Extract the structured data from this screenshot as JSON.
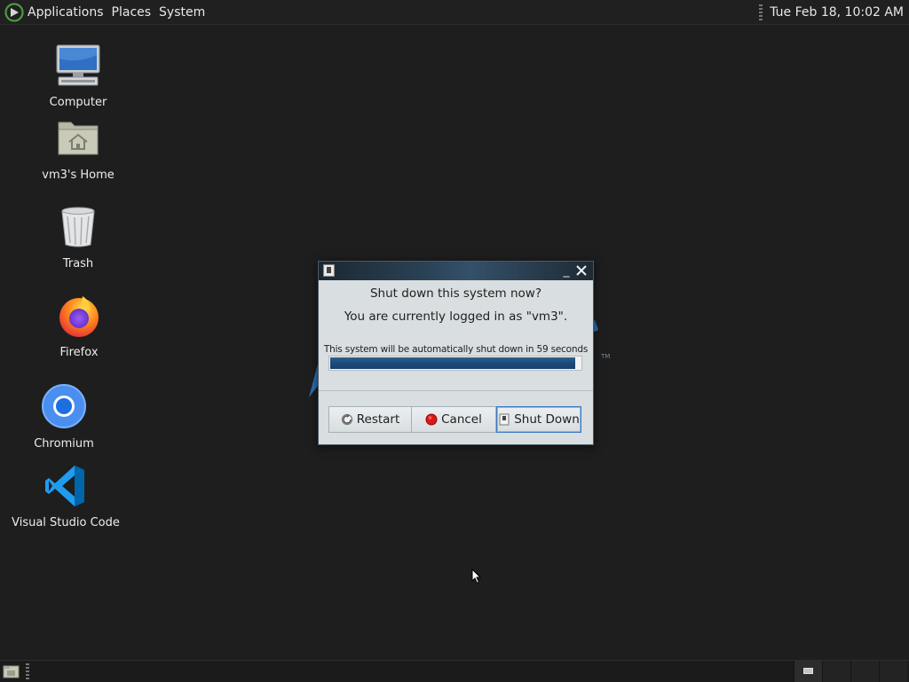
{
  "top_panel": {
    "menus": [
      "Applications",
      "Places",
      "System"
    ],
    "clock": "Tue Feb 18, 10:02 AM"
  },
  "desktop_icons": [
    {
      "label": "Computer",
      "icon": "computer-icon"
    },
    {
      "label": "vm3's Home",
      "icon": "home-folder-icon"
    },
    {
      "label": "Trash",
      "icon": "trash-icon"
    },
    {
      "label": "Firefox",
      "icon": "firefox-icon"
    },
    {
      "label": "Chromium",
      "icon": "chromium-icon"
    },
    {
      "label": "Visual Studio Code",
      "icon": "vscode-icon"
    }
  ],
  "dialog": {
    "heading": "Shut down this system now?",
    "subheading": "You are currently logged in as \"vm3\".",
    "progress_label": "This system will be automatically shut down in 59 seconds",
    "progress": 0.98,
    "buttons": {
      "restart": "Restart",
      "cancel": "Cancel",
      "shutdown": "Shut Down"
    }
  },
  "colors": {
    "desktop": "#1e1e1e",
    "dialog_bg": "#d9dee0",
    "progress": "#1e4c7c",
    "default_button_border": "#3b7bc0"
  }
}
